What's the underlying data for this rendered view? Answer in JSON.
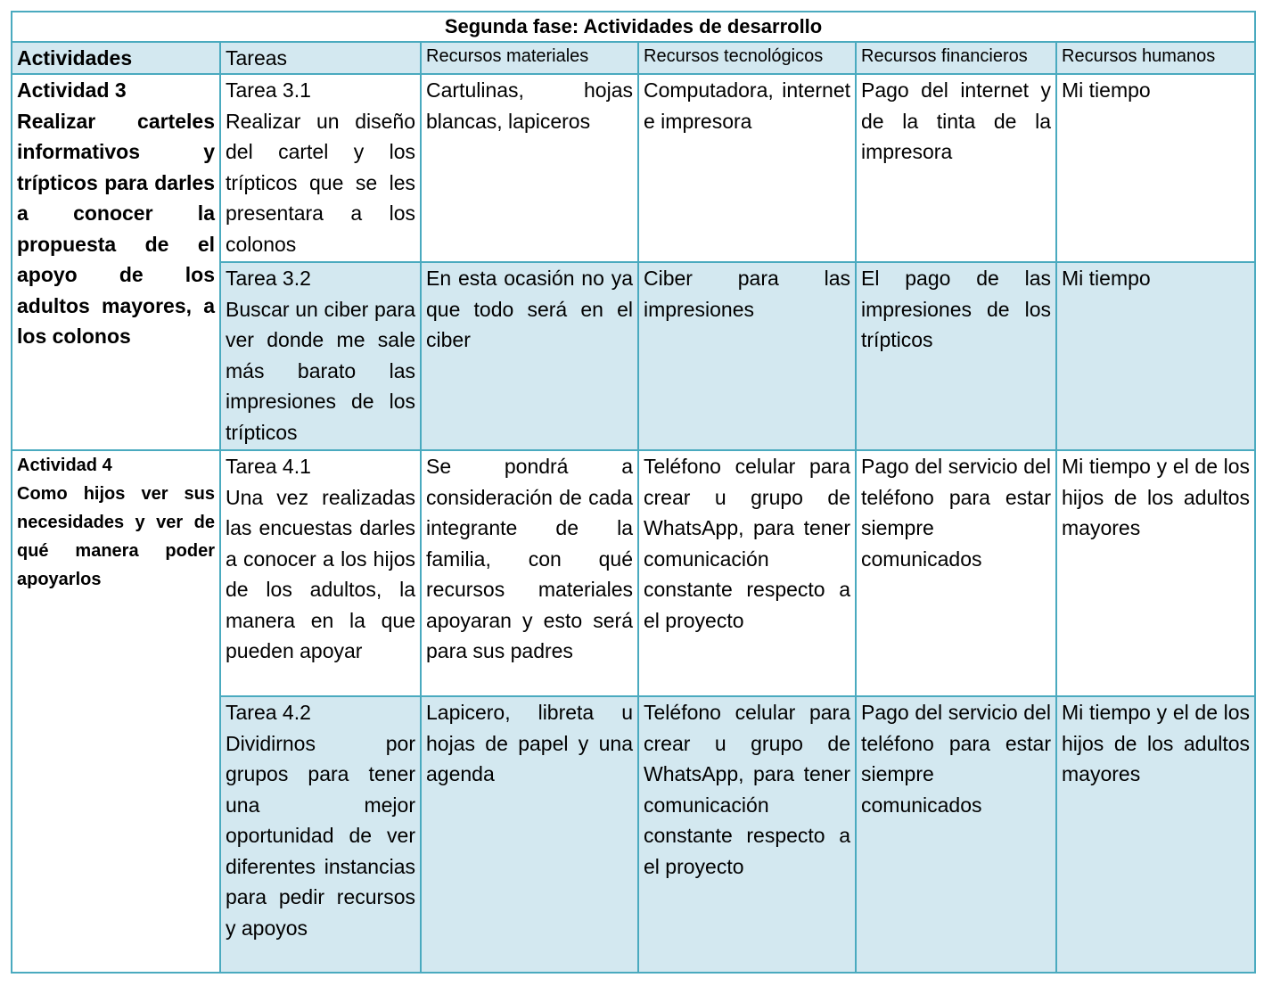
{
  "table": {
    "title": "Segunda fase: Actividades de desarrollo",
    "headers": [
      "Actividades",
      "Tareas",
      "Recursos materiales",
      "Recursos tecnológicos",
      "Recursos financieros",
      "Recursos humanos"
    ],
    "activities": [
      {
        "name": "Actividad 3",
        "description": "Realizar carteles informativos y trípticos para darles a conocer la propuesta de el apoyo de los adultos mayores, a los colonos",
        "tasks": [
          {
            "name": "Tarea 3.1",
            "description": "Realizar un diseño del cartel y los trípticos que se les presentara a los colonos",
            "materiales": "Cartulinas, hojas blancas, lapiceros",
            "tecnologicos": "Computadora, internet e impresora",
            "financieros": "Pago del internet y de la tinta de la impresora",
            "humanos": "Mi tiempo"
          },
          {
            "name": "Tarea 3.2",
            "description": "Buscar un ciber para ver donde me sale más barato las impresiones de los trípticos",
            "materiales": "En esta ocasión no ya que todo será en el ciber",
            "tecnologicos": "Ciber para las impresiones",
            "financieros": "El pago de las impresiones de los trípticos",
            "humanos": "Mi tiempo"
          }
        ]
      },
      {
        "name": "Actividad 4",
        "description": "Como hijos ver sus necesidades y ver de qué manera poder apoyarlos",
        "tasks": [
          {
            "name": "Tarea 4.1",
            "description": "Una vez realizadas las encuestas darles a conocer a los hijos de los adultos, la manera en la que pueden apoyar",
            "materiales": "Se pondrá a consideración de cada integrante de la familia, con qué recursos materiales apoyaran y esto será para sus padres",
            "tecnologicos": "Teléfono celular para crear u grupo de WhatsApp, para tener comunicación constante respecto a el proyecto",
            "financieros": "Pago del servicio del teléfono para estar siempre comunicados",
            "humanos": "Mi tiempo y el de los hijos de los adultos mayores"
          },
          {
            "name": "Tarea 4.2",
            "description": "Dividirnos por grupos para tener una mejor oportunidad de ver diferentes instancias para pedir recursos y apoyos",
            "materiales": "Lapicero, libreta u hojas de papel y una agenda",
            "tecnologicos": "Teléfono celular para crear u grupo de WhatsApp, para tener comunicación constante respecto a el proyecto",
            "financieros": "Pago del servicio del teléfono para estar siempre comunicados",
            "humanos": "Mi tiempo y el de los hijos de los adultos mayores"
          }
        ]
      }
    ]
  }
}
